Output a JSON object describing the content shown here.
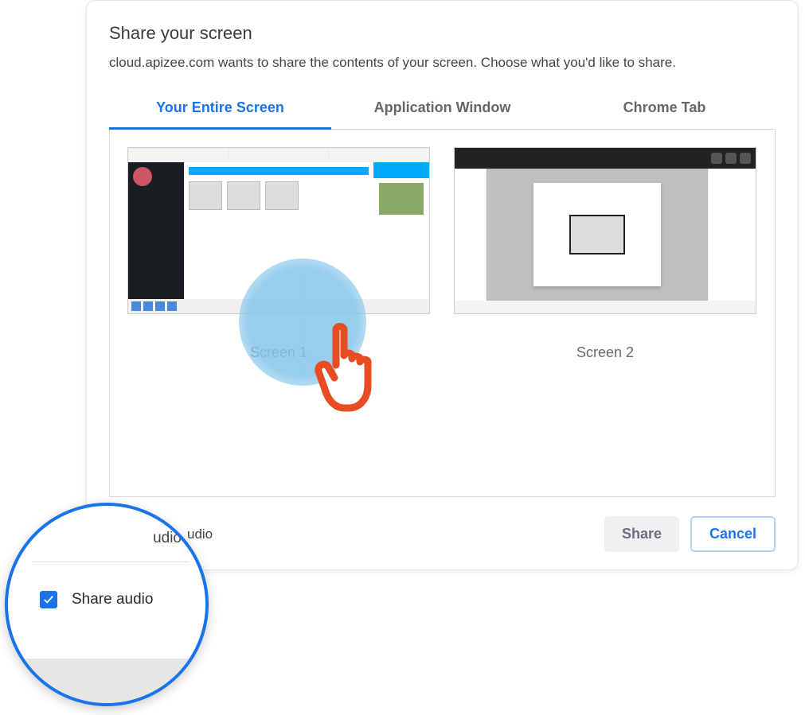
{
  "dialog": {
    "title": "Share your screen",
    "subtitle": "cloud.apizee.com wants to share the contents of your screen. Choose what you'd like to share."
  },
  "tabs": {
    "entire": "Your Entire Screen",
    "window": "Application Window",
    "chrome": "Chrome Tab"
  },
  "screens": {
    "s1": "Screen 1",
    "s2": "Screen 2"
  },
  "footer": {
    "share_audio_partial": "udio",
    "share": "Share",
    "cancel": "Cancel"
  },
  "zoom": {
    "share_audio": "Share audio"
  }
}
